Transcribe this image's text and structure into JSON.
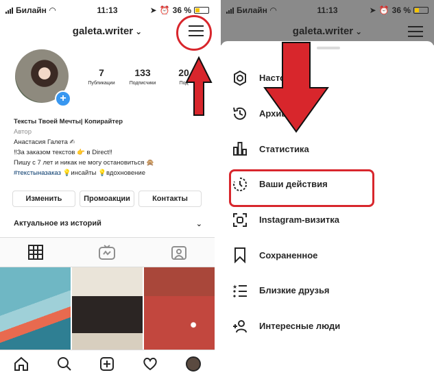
{
  "status_bar": {
    "carrier": "Билайн",
    "time": "11:13",
    "battery": "36 %"
  },
  "left": {
    "username": "galeta.writer",
    "stats": [
      {
        "value": "7",
        "label": "Публикации"
      },
      {
        "value": "133",
        "label": "Подписчики"
      },
      {
        "value": "20",
        "label": "Под"
      }
    ],
    "bio": {
      "name": "Тексты Твоей Мечты| Копирайтер",
      "category": "Автор",
      "line1": "Анастасия Галета ✍",
      "line2": "‼За заказом текстов 👉 в Direct‼",
      "line3": "Пишу с 7 лет и никак не могу остановиться 🙊",
      "hashtag": "#текстыназаказ",
      "line4_rest": " 💡инсайты 💡вдохновение"
    },
    "buttons": {
      "edit": "Изменить",
      "promo": "Промоакции",
      "contacts": "Контакты"
    },
    "highlights_label": "Актуальное из историй"
  },
  "right": {
    "username": "galeta.writer",
    "menu": [
      {
        "label": "Насто",
        "icon": "settings-icon"
      },
      {
        "label": "Архив",
        "icon": "archive-icon"
      },
      {
        "label": "Статистика",
        "icon": "insights-icon"
      },
      {
        "label": "Ваши действия",
        "icon": "activity-icon"
      },
      {
        "label": "Instagram-визитка",
        "icon": "nametag-icon"
      },
      {
        "label": "Сохраненное",
        "icon": "bookmark-icon"
      },
      {
        "label": "Близкие друзья",
        "icon": "close-friends-icon"
      },
      {
        "label": "Интересные люди",
        "icon": "discover-people-icon"
      }
    ]
  },
  "colors": {
    "annotation_red": "#d8262c",
    "link_blue": "#003569",
    "accent_blue": "#3897f0"
  }
}
